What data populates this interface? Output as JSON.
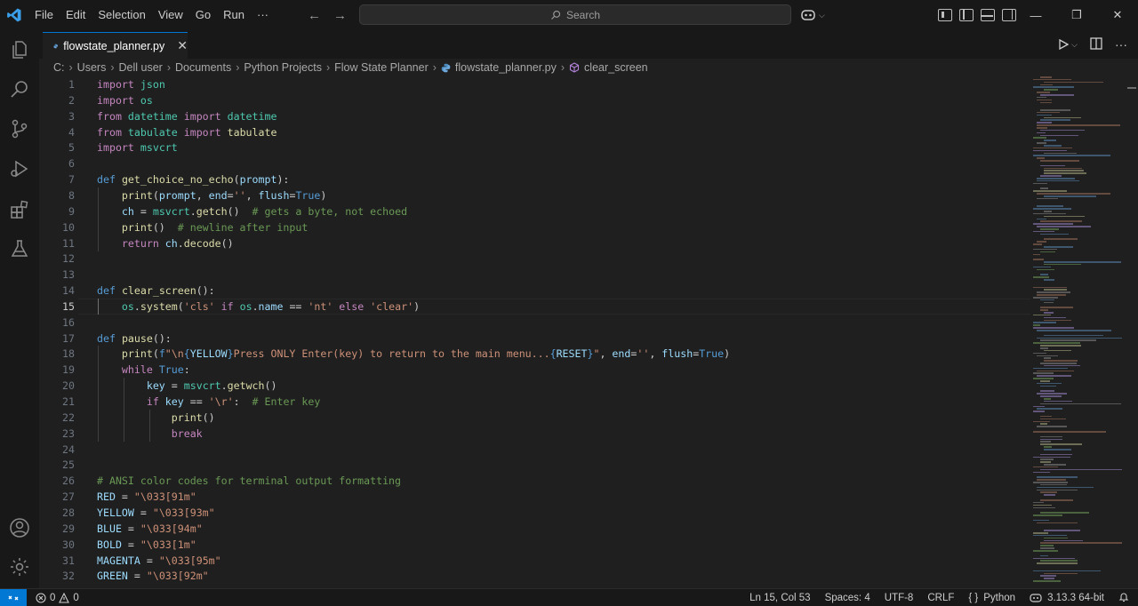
{
  "titlebar": {
    "menu": [
      "File",
      "Edit",
      "Selection",
      "View",
      "Go",
      "Run",
      "···"
    ],
    "search_placeholder": "Search"
  },
  "tab": {
    "filename": "flowstate_planner.py"
  },
  "breadcrumb": [
    "C:",
    "Users",
    "Dell user",
    "Documents",
    "Python Projects",
    "Flow State Planner",
    "flowstate_planner.py",
    "clear_screen"
  ],
  "code": {
    "active_line": 15,
    "line_numbers": [
      "1",
      "2",
      "3",
      "4",
      "5",
      "6",
      "7",
      "8",
      "9",
      "10",
      "11",
      "12",
      "13",
      "14",
      "15",
      "16",
      "17",
      "18",
      "19",
      "20",
      "21",
      "22",
      "23",
      "24",
      "25",
      "26",
      "27",
      "28",
      "29",
      "30",
      "31",
      "32"
    ],
    "lines": [
      [
        [
          "kw2",
          "import"
        ],
        [
          "t",
          " "
        ],
        [
          "cls",
          "json"
        ]
      ],
      [
        [
          "kw2",
          "import"
        ],
        [
          "t",
          " "
        ],
        [
          "cls",
          "os"
        ]
      ],
      [
        [
          "kw2",
          "from"
        ],
        [
          "t",
          " "
        ],
        [
          "cls",
          "datetime"
        ],
        [
          "t",
          " "
        ],
        [
          "kw2",
          "import"
        ],
        [
          "t",
          " "
        ],
        [
          "cls",
          "datetime"
        ]
      ],
      [
        [
          "kw2",
          "from"
        ],
        [
          "t",
          " "
        ],
        [
          "cls",
          "tabulate"
        ],
        [
          "t",
          " "
        ],
        [
          "kw2",
          "import"
        ],
        [
          "t",
          " "
        ],
        [
          "fn",
          "tabulate"
        ]
      ],
      [
        [
          "kw2",
          "import"
        ],
        [
          "t",
          " "
        ],
        [
          "cls",
          "msvcrt"
        ]
      ],
      [],
      [
        [
          "kw",
          "def"
        ],
        [
          "t",
          " "
        ],
        [
          "fn",
          "get_choice_no_echo"
        ],
        [
          "t",
          "("
        ],
        [
          "var",
          "prompt"
        ],
        [
          "t",
          "):"
        ]
      ],
      [
        [
          "t",
          "    "
        ],
        [
          "fn",
          "print"
        ],
        [
          "t",
          "("
        ],
        [
          "var",
          "prompt"
        ],
        [
          "t",
          ", "
        ],
        [
          "var",
          "end"
        ],
        [
          "t",
          "="
        ],
        [
          "str",
          "''"
        ],
        [
          "t",
          ", "
        ],
        [
          "var",
          "flush"
        ],
        [
          "t",
          "="
        ],
        [
          "kw",
          "True"
        ],
        [
          "t",
          ")"
        ]
      ],
      [
        [
          "t",
          "    "
        ],
        [
          "var",
          "ch"
        ],
        [
          "t",
          " = "
        ],
        [
          "cls",
          "msvcrt"
        ],
        [
          "t",
          "."
        ],
        [
          "fn",
          "getch"
        ],
        [
          "t",
          "()  "
        ],
        [
          "cm",
          "# gets a byte, not echoed"
        ]
      ],
      [
        [
          "t",
          "    "
        ],
        [
          "fn",
          "print"
        ],
        [
          "t",
          "()  "
        ],
        [
          "cm",
          "# newline after input"
        ]
      ],
      [
        [
          "t",
          "    "
        ],
        [
          "kw2",
          "return"
        ],
        [
          "t",
          " "
        ],
        [
          "var",
          "ch"
        ],
        [
          "t",
          "."
        ],
        [
          "fn",
          "decode"
        ],
        [
          "t",
          "()"
        ]
      ],
      [],
      [],
      [
        [
          "kw",
          "def"
        ],
        [
          "t",
          " "
        ],
        [
          "fn",
          "clear_screen"
        ],
        [
          "t",
          "():"
        ]
      ],
      [
        [
          "t",
          "    "
        ],
        [
          "cls",
          "os"
        ],
        [
          "t",
          "."
        ],
        [
          "fn",
          "system"
        ],
        [
          "t",
          "("
        ],
        [
          "str",
          "'cls'"
        ],
        [
          "t",
          " "
        ],
        [
          "kw2",
          "if"
        ],
        [
          "t",
          " "
        ],
        [
          "cls",
          "os"
        ],
        [
          "t",
          "."
        ],
        [
          "var",
          "name"
        ],
        [
          "t",
          " == "
        ],
        [
          "str",
          "'nt'"
        ],
        [
          "t",
          " "
        ],
        [
          "kw2",
          "else"
        ],
        [
          "t",
          " "
        ],
        [
          "str",
          "'clear'"
        ],
        [
          "t",
          ")"
        ]
      ],
      [],
      [
        [
          "kw",
          "def"
        ],
        [
          "t",
          " "
        ],
        [
          "fn",
          "pause"
        ],
        [
          "t",
          "():"
        ]
      ],
      [
        [
          "t",
          "    "
        ],
        [
          "fn",
          "print"
        ],
        [
          "t",
          "("
        ],
        [
          "kw",
          "f"
        ],
        [
          "str",
          "\"\\n"
        ],
        [
          "kw",
          "{"
        ],
        [
          "var",
          "YELLOW"
        ],
        [
          "kw",
          "}"
        ],
        [
          "str",
          "Press ONLY Enter(key) to return to the main menu..."
        ],
        [
          "kw",
          "{"
        ],
        [
          "var",
          "RESET"
        ],
        [
          "kw",
          "}"
        ],
        [
          "str",
          "\""
        ],
        [
          "t",
          ", "
        ],
        [
          "var",
          "end"
        ],
        [
          "t",
          "="
        ],
        [
          "str",
          "''"
        ],
        [
          "t",
          ", "
        ],
        [
          "var",
          "flush"
        ],
        [
          "t",
          "="
        ],
        [
          "kw",
          "True"
        ],
        [
          "t",
          ")"
        ]
      ],
      [
        [
          "t",
          "    "
        ],
        [
          "kw2",
          "while"
        ],
        [
          "t",
          " "
        ],
        [
          "kw",
          "True"
        ],
        [
          "t",
          ":"
        ]
      ],
      [
        [
          "t",
          "        "
        ],
        [
          "var",
          "key"
        ],
        [
          "t",
          " = "
        ],
        [
          "cls",
          "msvcrt"
        ],
        [
          "t",
          "."
        ],
        [
          "fn",
          "getwch"
        ],
        [
          "t",
          "()"
        ]
      ],
      [
        [
          "t",
          "        "
        ],
        [
          "kw2",
          "if"
        ],
        [
          "t",
          " "
        ],
        [
          "var",
          "key"
        ],
        [
          "t",
          " == "
        ],
        [
          "str",
          "'\\r'"
        ],
        [
          "t",
          ":  "
        ],
        [
          "cm",
          "# Enter key"
        ]
      ],
      [
        [
          "t",
          "            "
        ],
        [
          "fn",
          "print"
        ],
        [
          "t",
          "()"
        ]
      ],
      [
        [
          "t",
          "            "
        ],
        [
          "kw2",
          "break"
        ]
      ],
      [],
      [],
      [
        [
          "cm",
          "# ANSI color codes for terminal output formatting"
        ]
      ],
      [
        [
          "var",
          "RED"
        ],
        [
          "t",
          " = "
        ],
        [
          "str",
          "\"\\033[91m\""
        ]
      ],
      [
        [
          "var",
          "YELLOW"
        ],
        [
          "t",
          " = "
        ],
        [
          "str",
          "\"\\033[93m\""
        ]
      ],
      [
        [
          "var",
          "BLUE"
        ],
        [
          "t",
          " = "
        ],
        [
          "str",
          "\"\\033[94m\""
        ]
      ],
      [
        [
          "var",
          "BOLD"
        ],
        [
          "t",
          " = "
        ],
        [
          "str",
          "\"\\033[1m\""
        ]
      ],
      [
        [
          "var",
          "MAGENTA"
        ],
        [
          "t",
          " = "
        ],
        [
          "str",
          "\"\\033[95m\""
        ]
      ],
      [
        [
          "var",
          "GREEN"
        ],
        [
          "t",
          " = "
        ],
        [
          "str",
          "\"\\033[92m\""
        ]
      ]
    ]
  },
  "statusbar": {
    "errors": "0",
    "warnings": "0",
    "position": "Ln 15, Col 53",
    "spaces": "Spaces: 4",
    "encoding": "UTF-8",
    "eol": "CRLF",
    "language": "Python",
    "interpreter": "3.13.3 64-bit"
  },
  "colors": {
    "accent": "#0078d4",
    "background": "#1f1f1f",
    "chrome": "#181818"
  }
}
